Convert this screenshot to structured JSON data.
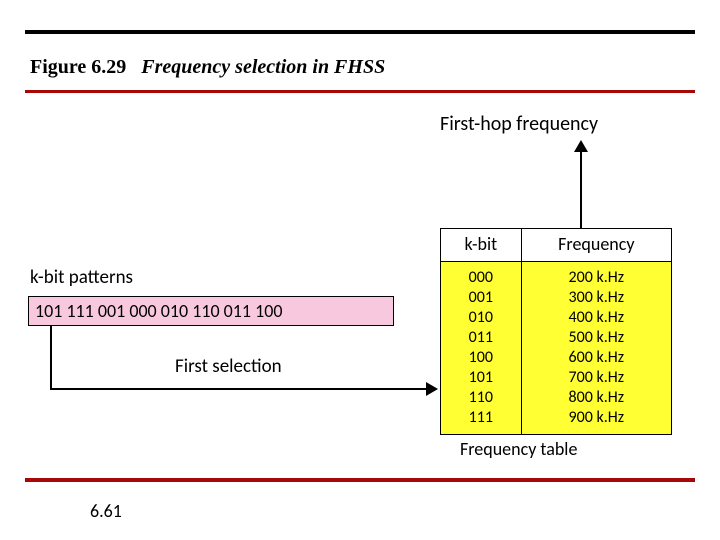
{
  "figure": {
    "number": "Figure 6.29",
    "caption": "Frequency selection in FHSS"
  },
  "labels": {
    "first_hop": "First-hop frequency",
    "kbit_patterns": "k-bit patterns",
    "first_selection": "First selection",
    "freq_table_caption": "Frequency table"
  },
  "pattern_sequence": "101  111  001  000  010  110  011  100",
  "table": {
    "headers": {
      "kbit": "k-bit",
      "freq": "Frequency"
    },
    "rows": [
      {
        "k": "000",
        "f": "200 k.Hz"
      },
      {
        "k": "001",
        "f": "300 k.Hz"
      },
      {
        "k": "010",
        "f": "400 k.Hz"
      },
      {
        "k": "011",
        "f": "500 k.Hz"
      },
      {
        "k": "100",
        "f": "600 k.Hz"
      },
      {
        "k": "101",
        "f": "700 k.Hz"
      },
      {
        "k": "110",
        "f": "800 k.Hz"
      },
      {
        "k": "111",
        "f": "900 k.Hz"
      }
    ]
  },
  "page": "6.61"
}
